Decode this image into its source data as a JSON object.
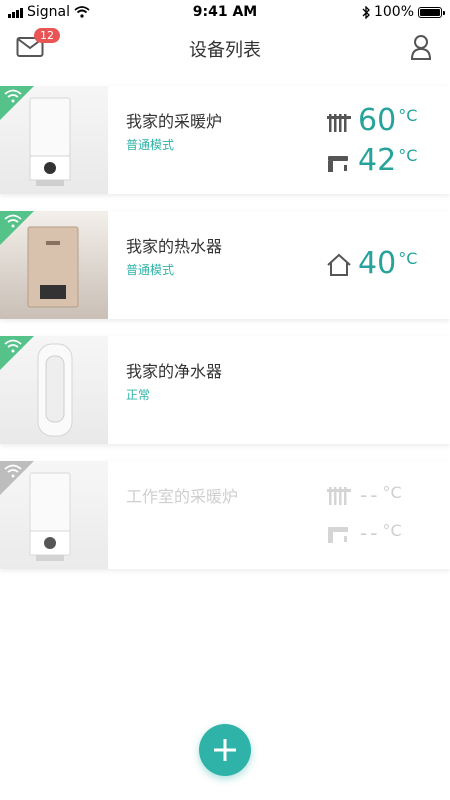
{
  "status_bar": {
    "carrier": "Signal",
    "time": "9:41 AM",
    "battery": "100%"
  },
  "header": {
    "title": "设备列表",
    "badge_count": "12"
  },
  "devices": [
    {
      "name": "我家的采暖炉",
      "mode": "普通模式",
      "temps": [
        {
          "icon": "radiator-icon",
          "value": "60",
          "unit": "°C"
        },
        {
          "icon": "faucet-icon",
          "value": "42",
          "unit": "°C"
        }
      ]
    },
    {
      "name": "我家的热水器",
      "mode": "普通模式",
      "temps": [
        {
          "icon": "house-icon",
          "value": "40",
          "unit": "°C"
        }
      ]
    },
    {
      "name": "我家的净水器",
      "mode": "正常",
      "temps": []
    },
    {
      "name": "工作室的采暖炉",
      "mode": "",
      "temps": [
        {
          "icon": "radiator-icon",
          "value": "--",
          "unit": "°C"
        },
        {
          "icon": "faucet-icon",
          "value": "--",
          "unit": "°C"
        }
      ]
    }
  ],
  "colors": {
    "accent": "#2fb3a8",
    "wifi_online": "#55c28a",
    "wifi_offline": "#bdbdbd",
    "badge": "#e85555"
  }
}
